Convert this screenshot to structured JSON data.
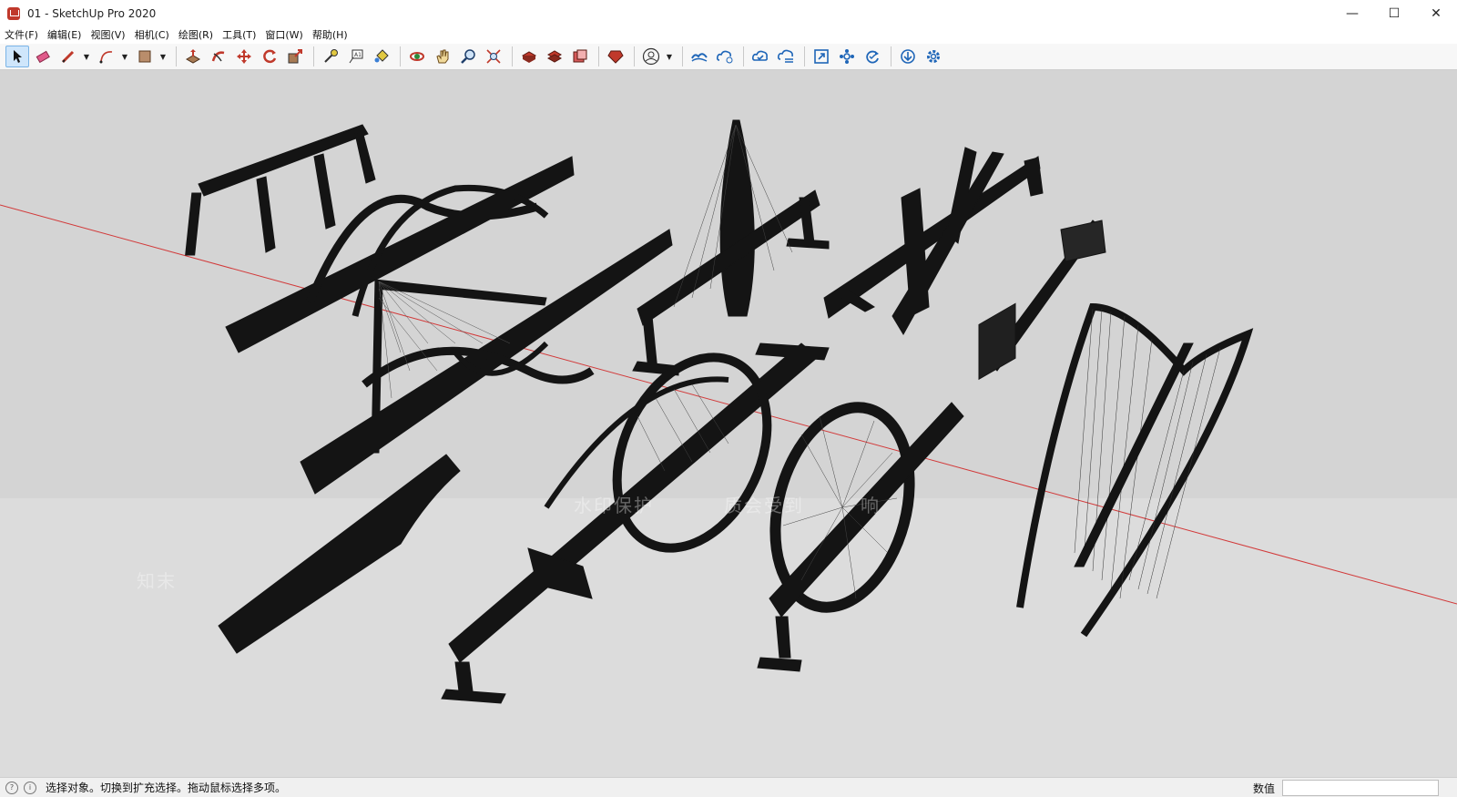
{
  "window": {
    "title": "01 - SketchUp Pro 2020",
    "minimize": "—",
    "maximize": "☐",
    "close": "✕"
  },
  "menu": [
    "文件(F)",
    "编辑(E)",
    "视图(V)",
    "相机(C)",
    "绘图(R)",
    "工具(T)",
    "窗口(W)",
    "帮助(H)"
  ],
  "toolbar": {
    "tools": [
      "select-tool",
      "eraser-tool",
      "pencil-tool",
      "arc-tool",
      "rectangle-tool",
      "push-pull-tool",
      "follow-me-tool",
      "move-tool",
      "rotate-tool",
      "scale-tool",
      "tape-measure-tool",
      "text-tool",
      "paint-bucket-tool",
      "orbit-tool",
      "pan-tool",
      "zoom-tool",
      "zoom-extents-tool",
      "warehouse-tool",
      "extension-warehouse-tool",
      "layout-tool",
      "ruby-console-tool",
      "profile-tool",
      "cloud-sync-tool",
      "cloud-share-tool",
      "cloud-upload-tool",
      "cloud-list-tool",
      "frame-tool",
      "components-tool",
      "refresh-tool",
      "download-tool",
      "settings-tool"
    ]
  },
  "viewport": {
    "watermark": "水印保护",
    "watermark_2": "质会受到",
    "watermark_3": "响",
    "watermark_logo": "知末"
  },
  "status": {
    "message": "选择对象。切换到扩充选择。拖动鼠标选择多项。",
    "measurements_label": "数值",
    "measurements_value": ""
  },
  "colors": {
    "viewport_bg": "#d4d4d4",
    "model": "#141414",
    "axis": "#d23a3a",
    "toolbar_active": "#cfe6fb"
  }
}
